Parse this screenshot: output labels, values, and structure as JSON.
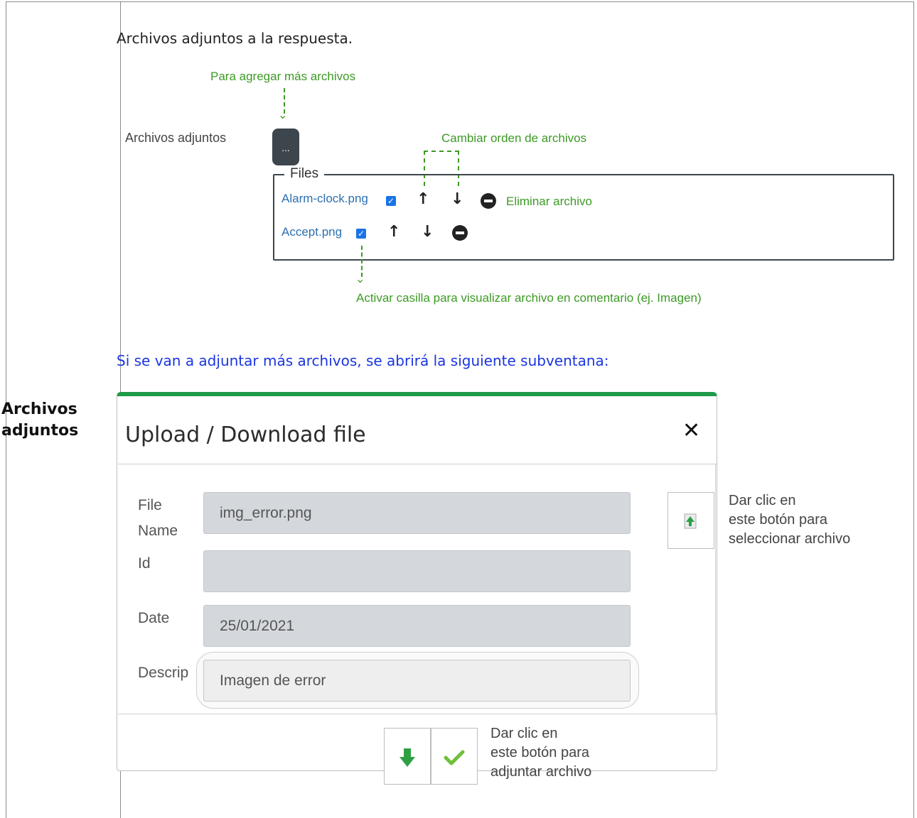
{
  "row_label": "Archivos adjuntos",
  "intro": "Archivos adjuntos a la respuesta.",
  "annotations": {
    "add_more": "Para agregar más archivos",
    "change_order": "Cambiar orden de archivos",
    "delete_file": "Eliminar archivo",
    "activate_checkbox": "Activar casilla para visualizar archivo en comentario (ej. Imagen)"
  },
  "attachments_label": "Archivos adjuntos",
  "dots_button": "...",
  "files_legend": "Files",
  "files": [
    {
      "name": "Alarm-clock.png"
    },
    {
      "name": "Accept.png"
    }
  ],
  "subwindow_note": "Si se van a adjuntar más archivos, se abrirá la siguiente subventana:",
  "dialog": {
    "title": "Upload / Download file",
    "close": "✕",
    "labels": {
      "file_name_1": "File",
      "file_name_2": "Name",
      "id": "Id",
      "date": "Date",
      "description": "Descrip"
    },
    "values": {
      "file_name": "img_error.png",
      "id": "",
      "date": "25/01/2021",
      "description": "Imagen de error"
    },
    "select_note": [
      "Dar clic en",
      "este botón para",
      "seleccionar archivo"
    ],
    "attach_note": [
      "Dar clic en",
      "este botón para",
      "adjuntar archivo"
    ]
  },
  "colors": {
    "accent_green": "#1f9a4a",
    "annotation_green": "#3c9a25",
    "link_blue": "#2c6fb0",
    "note_blue": "#1a35e0"
  }
}
